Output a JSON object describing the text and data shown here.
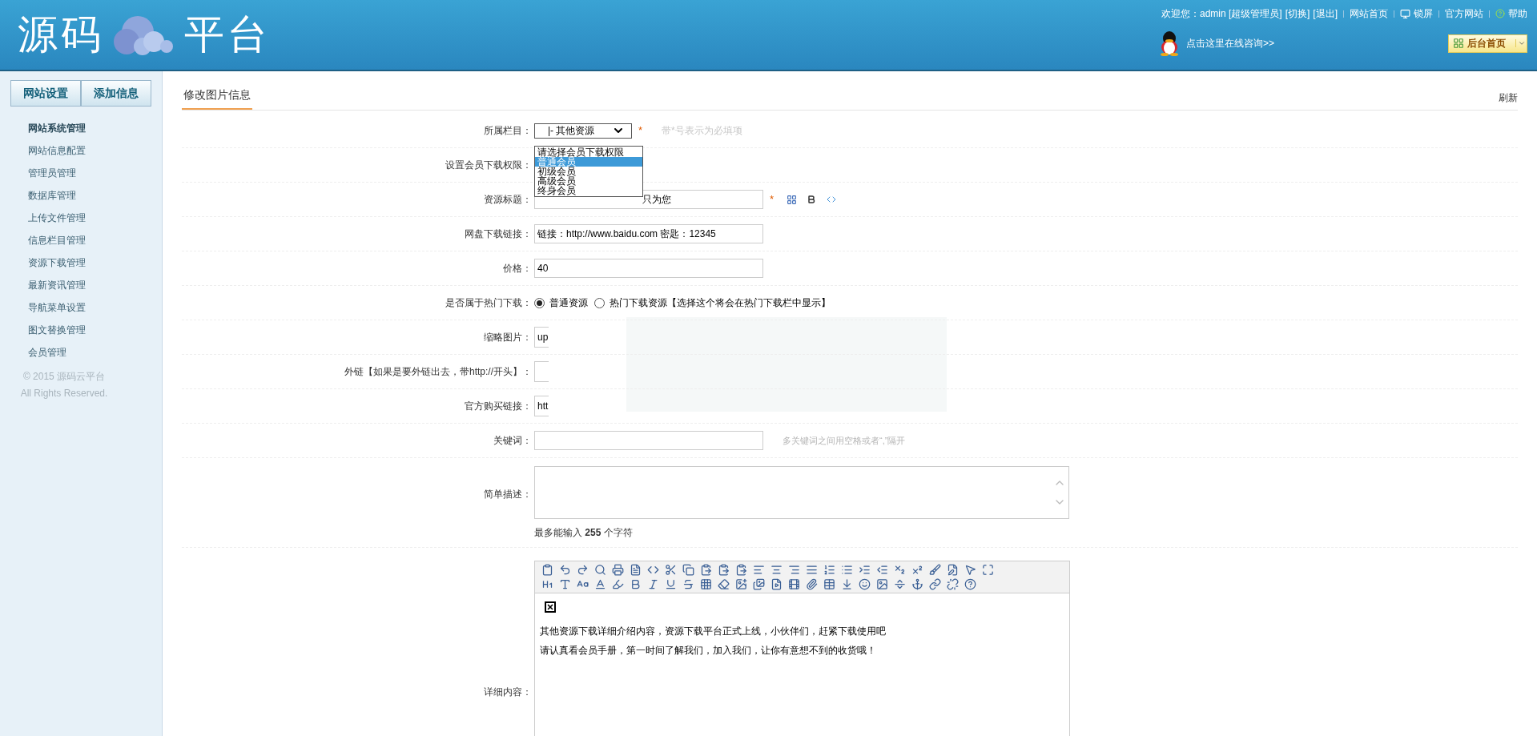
{
  "header": {
    "logo": [
      "源码",
      "平台"
    ],
    "welcome": "欢迎您：admin [超级管理员]",
    "top_links": [
      {
        "label": "[切换]",
        "kind": "link"
      },
      {
        "label": "[退出]",
        "kind": "link"
      },
      {
        "label": "网站首页",
        "kind": "link"
      },
      {
        "label": "锁屏",
        "kind": "lock"
      },
      {
        "label": "官方网站",
        "kind": "link"
      },
      {
        "label": "帮助",
        "kind": "help"
      }
    ],
    "consult": "点击这里在线咨询>>",
    "home_button": "后台首页"
  },
  "sidebar": {
    "tabs": [
      "网站设置",
      "添加信息"
    ],
    "items": [
      {
        "label": "网站系统管理",
        "kind": "heading"
      },
      {
        "label": "网站信息配置",
        "kind": "link"
      },
      {
        "label": "管理员管理",
        "kind": "link"
      },
      {
        "label": "数据库管理",
        "kind": "link"
      },
      {
        "label": "上传文件管理",
        "kind": "link"
      },
      {
        "label": "信息栏目管理",
        "kind": "link"
      },
      {
        "label": "资源下载管理",
        "kind": "link"
      },
      {
        "label": "最新资讯管理",
        "kind": "link"
      },
      {
        "label": "导航菜单设置",
        "kind": "link"
      },
      {
        "label": "图文替换管理",
        "kind": "link"
      },
      {
        "label": "会员管理",
        "kind": "link"
      }
    ],
    "footer": [
      "© 2015 源码云平台",
      "All Rights Reserved."
    ]
  },
  "page": {
    "title": "修改图片信息",
    "refresh": "刷新"
  },
  "form": [
    {
      "kind": "select",
      "label": "所属栏目：",
      "value": "|- 其他资源",
      "required_mark": "*",
      "hint": "带*号表示为必填项"
    },
    {
      "kind": "listbox",
      "label": "设置会员下载权限：",
      "options": [
        {
          "label": "请选择会员下载权限",
          "selected": false
        },
        {
          "label": "普通会员",
          "selected": true
        },
        {
          "label": "初级会员",
          "selected": false
        },
        {
          "label": "高级会员",
          "selected": false
        },
        {
          "label": "终身会员",
          "selected": false
        }
      ]
    },
    {
      "kind": "title",
      "label": "资源标题：",
      "value": "只为您",
      "required_mark": "*"
    },
    {
      "kind": "text",
      "label": "网盘下载链接：",
      "value": "链接：http://www.baidu.com 密匙：12345"
    },
    {
      "kind": "text",
      "label": "价格：",
      "value": "40"
    },
    {
      "kind": "radio",
      "label": "是否属于热门下载：",
      "options": [
        {
          "label": "普通资源",
          "selected": true
        },
        {
          "label": "热门下载资源【选择这个将会在热门下载栏中显示】",
          "selected": false
        }
      ]
    },
    {
      "kind": "narrow",
      "label": "缩略图片：",
      "value": "up"
    },
    {
      "kind": "narrow",
      "label": "外链【如果是要外链出去，带http://开头】："
    },
    {
      "kind": "narrow",
      "label": "官方购买链接：",
      "value": "htt"
    },
    {
      "kind": "text",
      "label": "关键词：",
      "hint": "多关键词之间用空格或者“,”隔开"
    },
    {
      "kind": "textarea",
      "label": "简单描述：",
      "note": "最多能输入 **255** 个字符"
    },
    {
      "kind": "editor",
      "label": "详细内容：",
      "paragraphs": [
        "其他资源下载详细介绍内容，资源下载平台正式上线，小伙伴们，赶紧下载使用吧",
        "请认真看会员手册，第一时间了解我们，加入我们，让你有意想不到的收货哦！"
      ]
    }
  ]
}
